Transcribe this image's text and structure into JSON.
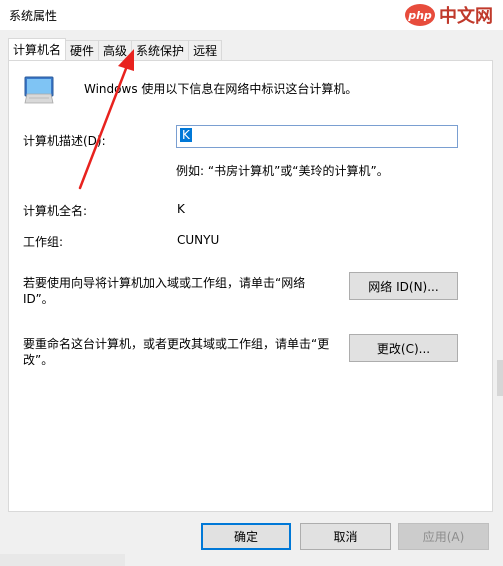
{
  "window": {
    "title": "系统属性"
  },
  "watermark": {
    "badge": "php",
    "text": "中文网"
  },
  "tabs": [
    {
      "label": "计算机名",
      "active": true
    },
    {
      "label": "硬件",
      "active": false
    },
    {
      "label": "高级",
      "active": false
    },
    {
      "label": "系统保护",
      "active": false
    },
    {
      "label": "远程",
      "active": false
    }
  ],
  "panel": {
    "info_text": "Windows 使用以下信息在网络中标识这台计算机。",
    "description_label": "计算机描述(D):",
    "description_value": "K",
    "example_text": "例如: “书房计算机”或“美玲的计算机”。",
    "fullname_label": "计算机全名:",
    "fullname_value": "K",
    "workgroup_label": "工作组:",
    "workgroup_value": "CUNYU",
    "network_text_line1": "若要使用向导将计算机加入域或工作组，请单击“网络",
    "network_text_line2": "ID”。",
    "network_button": "网络 ID(N)...",
    "rename_text_line1": "要重命名这台计算机，或者更改其域或工作组，请单击“更",
    "rename_text_line2": "改”。",
    "change_button": "更改(C)..."
  },
  "footer": {
    "ok": "确定",
    "cancel": "取消",
    "apply": "应用(A)"
  },
  "annotation": {
    "arrow_color": "#e8221e"
  }
}
